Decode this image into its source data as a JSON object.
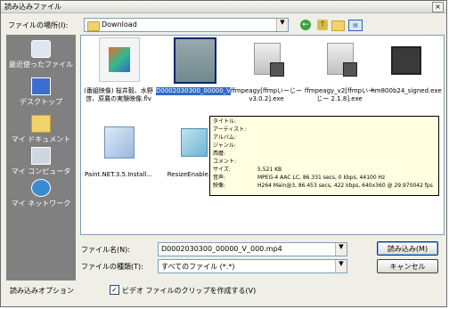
{
  "window": {
    "title": "読み込みファイル",
    "close": "×"
  },
  "lookin": {
    "label": "ファイルの場所(I):",
    "value": "Download",
    "dropdown": "▼"
  },
  "toolbar": {
    "back": "←",
    "up": "↑",
    "views": "▤"
  },
  "places": [
    {
      "label": "最近使ったファイル",
      "icon": "recent-icon"
    },
    {
      "label": "デスクトップ",
      "icon": "desktop-icon"
    },
    {
      "label": "マイ ドキュメント",
      "icon": "documents-icon"
    },
    {
      "label": "マイ コンピュータ",
      "icon": "computer-icon"
    },
    {
      "label": "マイ ネットワーク",
      "icon": "network-icon"
    }
  ],
  "files": [
    {
      "name": "(番組映像) 桜井毅、水野 啓、原農の実験映像.flv",
      "thumb": "media-icon"
    },
    {
      "name": "D0002030300_00000_V_000.mp4",
      "thumb": "video-thumbnail",
      "selected": true
    },
    {
      "name": "ffmpeagy[ffmpいーじー v3.0.2].exe",
      "thumb": "installer-icon"
    },
    {
      "name": "ffmpeagy_v2[ffmpいーじー 2.1.8].exe",
      "thumb": "installer-icon"
    },
    {
      "name": "hm800b24_signed.exe",
      "thumb": "app-icon"
    },
    {
      "name": "Paint.NET.3.5.Install...",
      "thumb": "paint-icon"
    },
    {
      "name": "ResizeEnable.zip",
      "thumb": "zip-icon"
    }
  ],
  "tooltip": [
    {
      "k": "タイトル:",
      "v": ""
    },
    {
      "k": "アーティスト:",
      "v": ""
    },
    {
      "k": "アルバム:",
      "v": ""
    },
    {
      "k": "ジャンル:",
      "v": ""
    },
    {
      "k": "西暦:",
      "v": ""
    },
    {
      "k": "コメント:",
      "v": ""
    },
    {
      "k": "サイズ:",
      "v": "5,521 KB"
    },
    {
      "k": "音声:",
      "v": "MPEG-4 AAC LC, 86.331 secs, 0 kbps, 44100 Hz"
    },
    {
      "k": "映像:",
      "v": "H264 Main@3, 86.453 secs, 422 kbps, 640x360 @ 29.970042 fps"
    }
  ],
  "filename": {
    "label": "ファイル名(N):",
    "value": "D0002030300_00000_V_000.mp4"
  },
  "filetype": {
    "label": "ファイルの種類(T):",
    "value": "すべてのファイル (*.*)"
  },
  "buttons": {
    "open": "読み込み(M)",
    "cancel": "キャンセル"
  },
  "options": {
    "label": "読み込みオプション",
    "checkbox_label": "ビデオ ファイルのクリップを作成する(V)",
    "checked": "✓"
  }
}
